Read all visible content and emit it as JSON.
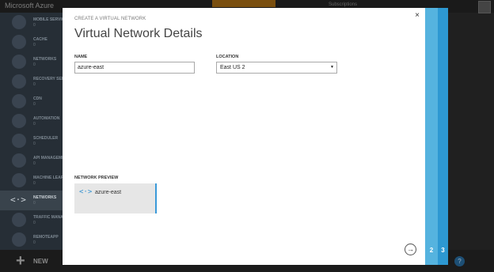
{
  "portal": {
    "brand": "Microsoft Azure",
    "top_right": "Subscriptions",
    "sidebar": [
      {
        "label": "MOBILE SERVICES",
        "count": "0"
      },
      {
        "label": "CACHE",
        "count": "0"
      },
      {
        "label": "NETWORKS",
        "count": "0"
      },
      {
        "label": "RECOVERY SERVICES",
        "count": "0"
      },
      {
        "label": "CDN",
        "count": "0"
      },
      {
        "label": "AUTOMATION",
        "count": "0"
      },
      {
        "label": "SCHEDULER",
        "count": "0"
      },
      {
        "label": "API MANAGEMENT",
        "count": "0"
      },
      {
        "label": "MACHINE LEARNING",
        "count": "0"
      },
      {
        "label": "NETWORKS",
        "count": "0",
        "active": true
      },
      {
        "label": "TRAFFIC MANAGER",
        "count": "0"
      },
      {
        "label": "REMOTEAPP",
        "count": "0"
      }
    ],
    "new_label": "NEW",
    "help": "?"
  },
  "dialog": {
    "subtitle": "CREATE A VIRTUAL NETWORK",
    "title": "Virtual Network Details",
    "close": "×",
    "name_label": "NAME",
    "name_value": "azure-east",
    "location_label": "LOCATION",
    "location_value": "East US 2",
    "preview_label": "NETWORK PREVIEW",
    "preview_name": "azure-east",
    "next": "→",
    "steps": [
      "2",
      "3"
    ]
  },
  "colors": {
    "accent": "#2d98d2",
    "step_light": "#55b3df"
  }
}
